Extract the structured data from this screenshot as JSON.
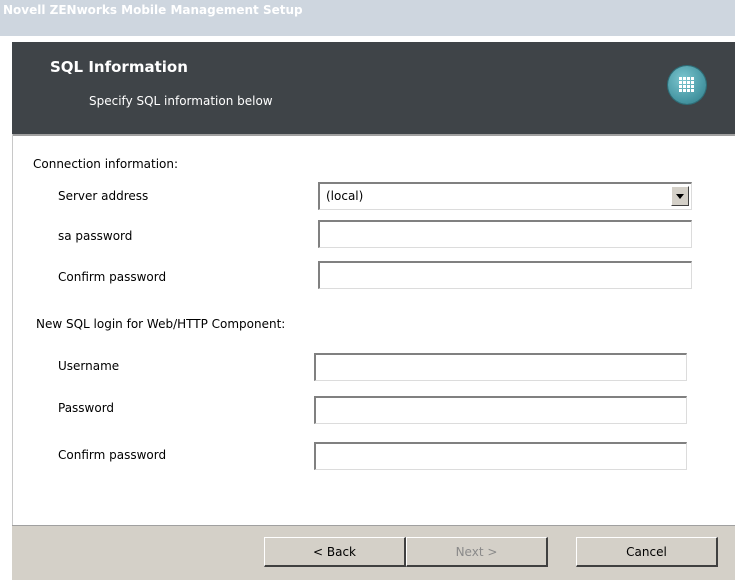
{
  "window": {
    "title": "Novell ZENworks Mobile Management Setup"
  },
  "header": {
    "title": "SQL Information",
    "subtitle": "Specify SQL information below",
    "icon": "apps-grid-icon"
  },
  "connection": {
    "section_label": "Connection information:",
    "server_address_label": "Server address",
    "server_address_value": "(local)",
    "sa_password_label": "sa password",
    "sa_password_value": "",
    "confirm_password_label": "Confirm password",
    "confirm_password_value": ""
  },
  "web_login": {
    "section_label": "New SQL login for Web/HTTP Component:",
    "username_label": "Username",
    "username_value": "",
    "password_label": "Password",
    "password_value": "",
    "confirm_password_label": "Confirm password",
    "confirm_password_value": ""
  },
  "buttons": {
    "back": "< Back",
    "next": "Next >",
    "cancel": "Cancel",
    "next_enabled": false
  },
  "colors": {
    "titlebar_bg": "#ced6df",
    "header_bg": "#3f4448",
    "footer_bg": "#d4d0c8",
    "icon_accent": "#4a9aa6"
  }
}
